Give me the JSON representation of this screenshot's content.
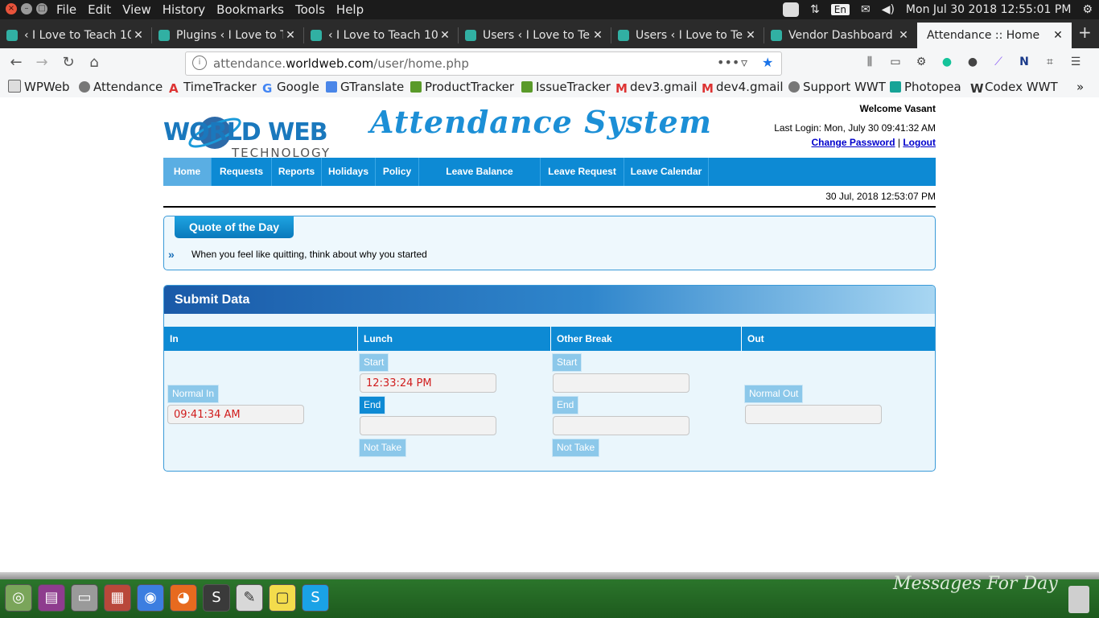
{
  "os_bar": {
    "menu": [
      "File",
      "Edit",
      "View",
      "History",
      "Bookmarks",
      "Tools",
      "Help"
    ],
    "lang": "En",
    "clock": "Mon Jul 30 2018 12:55:01 PM"
  },
  "tabs": [
    {
      "title": "‹ I Love to Teach 10"
    },
    {
      "title": "Plugins ‹ I Love to T"
    },
    {
      "title": "‹ I Love to Teach 10"
    },
    {
      "title": "Users ‹ I Love to Tea"
    },
    {
      "title": "Users ‹ I Love to Tea"
    },
    {
      "title": "Vendor Dashboard"
    },
    {
      "title": "Attendance :: Home"
    }
  ],
  "url": {
    "prefix": "attendance.",
    "domain": "worldweb.com",
    "path": "/user/home.php"
  },
  "bookmarks": [
    "WPWeb",
    "Attendance",
    "TimeTracker",
    "Google",
    "GTranslate",
    "ProductTracker",
    "IssueTracker",
    "dev3.gmail",
    "dev4.gmail",
    "Support WWT",
    "Photopea",
    "Codex WWT"
  ],
  "header": {
    "logo_main": "WORLD WEB",
    "logo_sub": "TECHNOLOGY",
    "app_title": "Attendance System",
    "welcome": "Welcome Vasant",
    "last_login": "Last Login: Mon, July 30 09:41:32 AM",
    "change_password": "Change Password",
    "separator": "|",
    "logout": "Logout"
  },
  "nav": [
    "Home",
    "Requests",
    "Reports",
    "Holidays",
    "Policy",
    "Leave Balance",
    "Leave Request",
    "Leave Calendar"
  ],
  "server_date": "30 Jul, 2018 12:53:07 PM",
  "quote": {
    "title": "Quote of the Day",
    "arrow": "»",
    "text": "When you feel like quitting, think about why you started"
  },
  "submit": {
    "title": "Submit Data",
    "columns": [
      "In",
      "Lunch",
      "Other Break",
      "Out"
    ],
    "normal_in_label": "Normal In",
    "normal_in_value": "09:41:34 AM",
    "lunch": {
      "start_label": "Start",
      "start_value": "12:33:24 PM",
      "end_label": "End",
      "end_value": "",
      "not_take": "Not Take"
    },
    "other": {
      "start_label": "Start",
      "start_value": "",
      "end_label": "End",
      "end_value": "",
      "not_take": "Not Take"
    },
    "normal_out_label": "Normal Out",
    "normal_out_value": ""
  },
  "dock": {
    "message": "Messages For Day"
  },
  "colors": {
    "accent": "#0d8ad4",
    "time_red": "#d01c1c",
    "dock_green": "#2e7a2e"
  }
}
